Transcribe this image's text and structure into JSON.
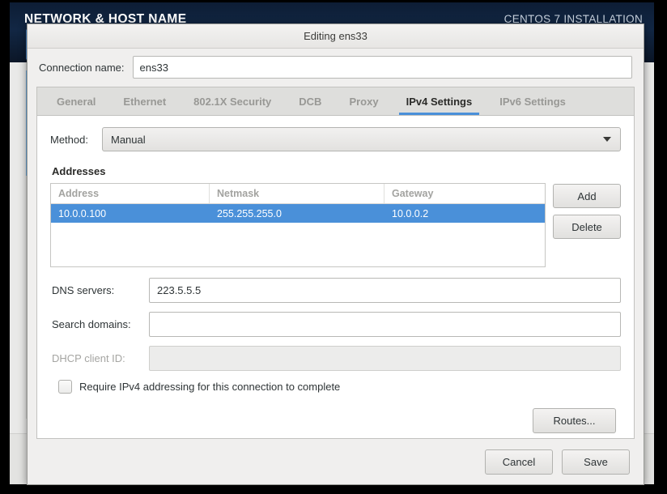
{
  "installer": {
    "page_title": "NETWORK & HOST NAME",
    "product_title": "CENTOS 7 INSTALLATION"
  },
  "dialog": {
    "title": "Editing ens33",
    "connection_name": {
      "label": "Connection name:",
      "value": "ens33"
    },
    "tabs": [
      {
        "label": "General",
        "active": false
      },
      {
        "label": "Ethernet",
        "active": false
      },
      {
        "label": "802.1X Security",
        "active": false
      },
      {
        "label": "DCB",
        "active": false
      },
      {
        "label": "Proxy",
        "active": false
      },
      {
        "label": "IPv4 Settings",
        "active": true
      },
      {
        "label": "IPv6 Settings",
        "active": false
      }
    ],
    "ipv4": {
      "method": {
        "label": "Method:",
        "value": "Manual",
        "arrow_icon": "chevron-down-icon"
      },
      "addresses": {
        "section_title": "Addresses",
        "columns": [
          "Address",
          "Netmask",
          "Gateway"
        ],
        "rows": [
          {
            "address": "10.0.0.100",
            "netmask": "255.255.255.0",
            "gateway": "10.0.0.2",
            "selected": true
          }
        ],
        "add_label": "Add",
        "delete_label": "Delete"
      },
      "dns_servers": {
        "label": "DNS servers:",
        "value": "223.5.5.5",
        "placeholder": ""
      },
      "search_domains": {
        "label": "Search domains:",
        "value": "",
        "placeholder": ""
      },
      "dhcp_client_id": {
        "label": "DHCP client ID:",
        "value": "",
        "placeholder": "",
        "disabled": true
      },
      "require_ipv4": {
        "label": "Require IPv4 addressing for this connection to complete",
        "checked": false
      },
      "routes_label": "Routes..."
    },
    "cancel_label": "Cancel",
    "save_label": "Save"
  },
  "colors": {
    "selection_blue": "#4a90d9",
    "tab_underline": "#4a90d9",
    "header_navy": "#122744",
    "dialog_bg": "#f0efee"
  }
}
